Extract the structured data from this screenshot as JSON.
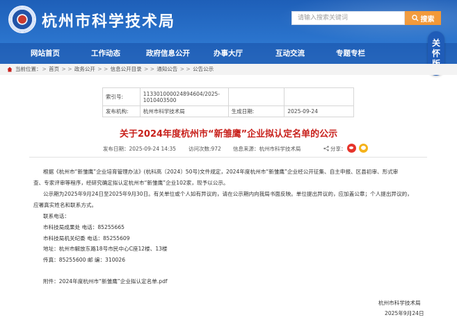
{
  "header": {
    "site_title": "杭州市科学技术局",
    "search_placeholder": "请输入搜索关键词",
    "search_button": "搜索",
    "care_mode": [
      "关",
      "怀",
      "版"
    ]
  },
  "nav": {
    "items": [
      "网站首页",
      "工作动态",
      "政府信息公开",
      "办事大厅",
      "互动交流",
      "专题专栏"
    ]
  },
  "breadcrumb": {
    "prefix": "当前位置：",
    "items": [
      "首页",
      "政务公开",
      "信息公开目录",
      "通知公告",
      "公告公示"
    ]
  },
  "info": {
    "index_label": "索引号:",
    "index_value": "113301000024894604/2025-1010403500",
    "org_label": "发布机构:",
    "org_value": "杭州市科学技术局",
    "date_label": "生成日期:",
    "date_value": "2025-09-24"
  },
  "article": {
    "title": "关于2024年度杭州市“新雏鹰”企业拟认定名单的公示",
    "publish_date": "发布日期：2025-09-24 14:35",
    "views": "访问次数:972",
    "source": "信息来源：杭州市科学技术局",
    "share_label": "分享："
  },
  "content": {
    "para1_line1": "根据《杭州市“新雏鹰”企业培育管理办法》(杭科高〔2024〕50号)文件规定，2024年度杭州市“新雏鹰”企业经公开征集、自主申报、区县初审、形式审",
    "para1_line2": "查、专家评审等程序，经研究确定拟认定杭州市“新雏鹰”企业102家，现予以公示。",
    "para2_line1": "公示期为2025年9月24日至2025年9月30日。有关单位或个人如有异议的，请在公示期内向我局书面反映。单位提出异议的，应加盖公章；个人提出异议的，",
    "para2_line2": "应署真实姓名和联系方式。",
    "contact_title": "联系电话：",
    "contact1": "市科技局成果处 电话：85255665",
    "contact2": "市科技局机关纪委 电话：85255609",
    "address": "地址：杭州市解放东路18号市民中心C座12楼、13楼",
    "fax": "传真：85255600 邮 编：310026",
    "attachment": "附件：2024年度杭州市“新雏鹰”企业拟认定名单.pdf"
  },
  "signature": {
    "org": "杭州市科学技术局",
    "date": "2025年9月24日"
  }
}
